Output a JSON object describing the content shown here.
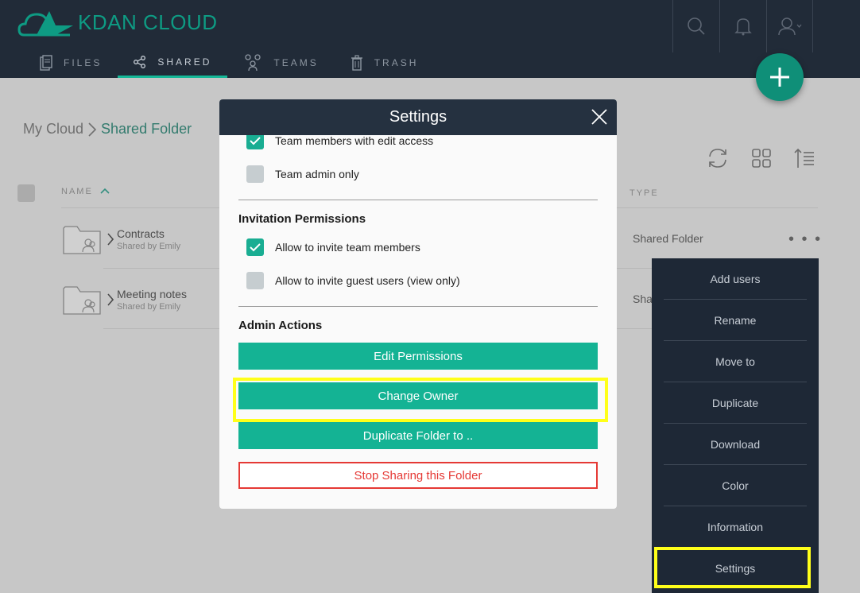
{
  "app": {
    "logo_text": "KDAN CLOUD"
  },
  "nav": [
    {
      "label": "FILES",
      "icon": "file-icon"
    },
    {
      "label": "SHARED",
      "icon": "share-icon"
    },
    {
      "label": "TEAMS",
      "icon": "teams-icon"
    },
    {
      "label": "TRASH",
      "icon": "trash-icon"
    }
  ],
  "breadcrumb": {
    "root": "My Cloud",
    "current": "Shared Folder"
  },
  "table": {
    "col_name": "NAME",
    "col_type": "TYPE",
    "rows": [
      {
        "name": "Contracts",
        "sub": "Shared by Emily",
        "type": "Shared Folder"
      },
      {
        "name": "Meeting notes",
        "sub": "Shared by Emily",
        "type": "Sha"
      }
    ]
  },
  "more_label": "• • •",
  "context_menu": [
    "Add users",
    "Rename",
    "Move to",
    "Duplicate",
    "Download",
    "Color",
    "Information",
    "Settings"
  ],
  "modal": {
    "title": "Settings",
    "opt_edit_access": "Team members with edit access",
    "opt_admin_only": "Team admin only",
    "invite_title": "Invitation Permissions",
    "opt_invite_team": "Allow to invite team members",
    "opt_invite_guest": "Allow to invite guest users (view only)",
    "admin_title": "Admin Actions",
    "btn_edit": "Edit Permissions",
    "btn_owner": "Change Owner",
    "btn_duplicate": "Duplicate Folder to ..",
    "btn_stop": "Stop Sharing this Folder"
  },
  "colors": {
    "accent": "#14b394",
    "highlight": "#ffff1a",
    "danger": "#e53935",
    "header": "#212b38"
  }
}
